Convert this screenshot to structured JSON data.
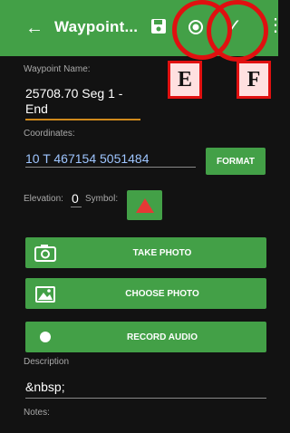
{
  "appbar": {
    "title": "Waypoint...",
    "icons": [
      "back-arrow-icon",
      "save-icon",
      "locate-icon",
      "check-icon",
      "more-vert-icon"
    ]
  },
  "annotations": {
    "e": "E",
    "f": "F"
  },
  "form": {
    "waypoint_name_label": "Waypoint Name:",
    "waypoint_name_value": "25708.70 Seg 1 - End",
    "coordinates_label": "Coordinates:",
    "coordinates_value": "10 T 467154 5051484",
    "format_button": "FORMAT",
    "elevation_label": "Elevation:",
    "elevation_value": "0",
    "symbol_label": "Symbol:",
    "symbol_color": "#e53935",
    "take_photo": "TAKE PHOTO",
    "choose_photo": "CHOOSE PHOTO",
    "record_audio": "RECORD AUDIO",
    "description_label": "Description",
    "description_value": "&nbsp;",
    "notes_label": "Notes:"
  },
  "colors": {
    "accent": "#43a047",
    "background": "#121212",
    "highlight": "#e01010"
  }
}
